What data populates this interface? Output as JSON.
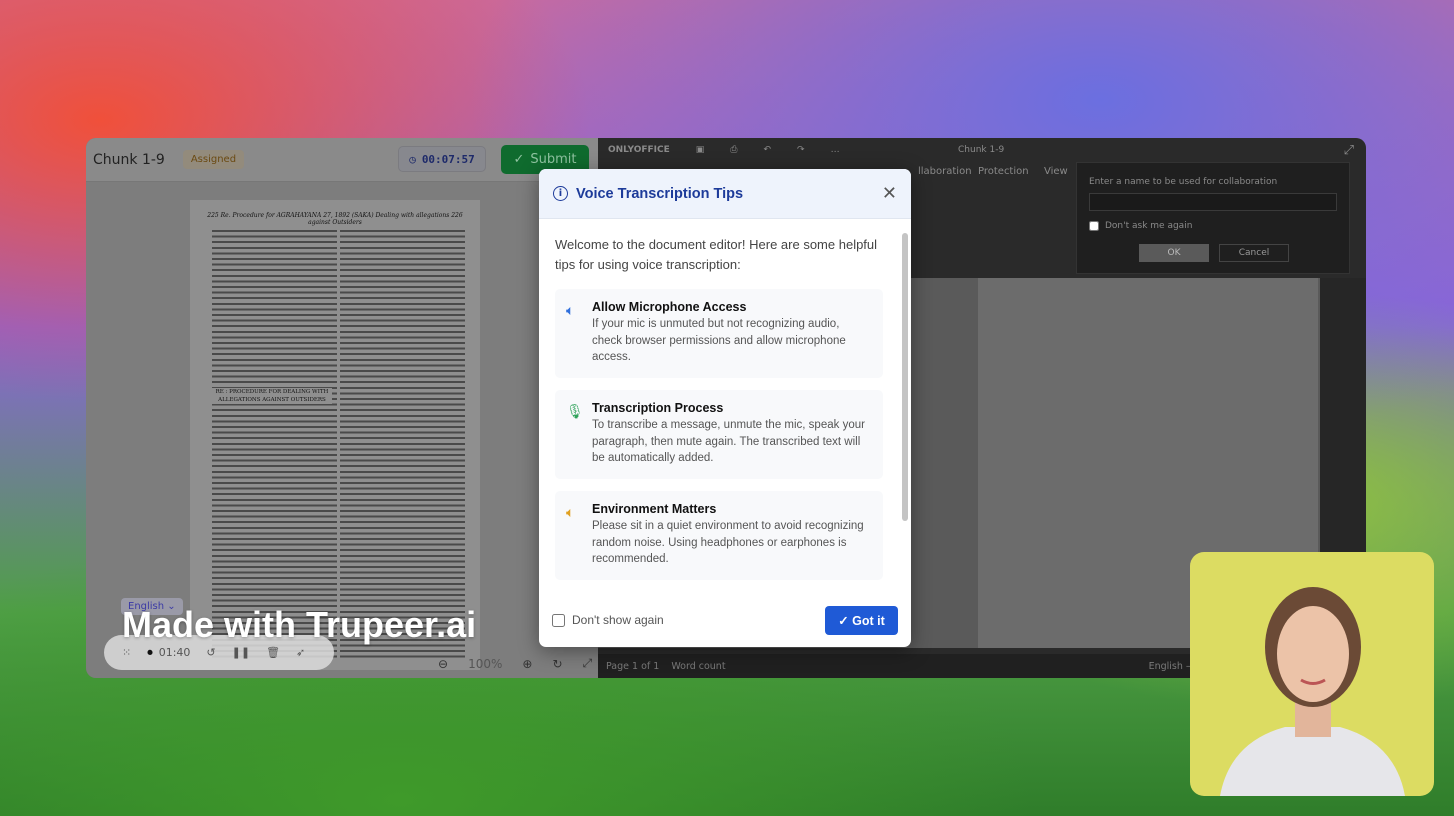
{
  "left_panel": {
    "title": "Chunk 1-9",
    "status_badge": "Assigned",
    "timer": "00:07:57",
    "submit_label": "Submit",
    "document": {
      "header": "225 Re. Procedure for AGRAHAYANA 27, 1892 (SAKA) Dealing with allegations 226 against Outsiders",
      "section_heading": "RE : PROCEDURE FOR DEALING WITH ALLEGATIONS AGAINST OUTSIDERS"
    },
    "language": "English",
    "zoom_level": "100%"
  },
  "recorder": {
    "elapsed": "01:40"
  },
  "watermark": "Made with Trupeer.ai",
  "editor": {
    "brand": "ONLYOFFICE",
    "doc_title": "Chunk 1-9",
    "tabs": [
      "llaboration",
      "Protection",
      "View"
    ],
    "collab_dialog": {
      "label": "Enter a name to be used for collaboration",
      "checkbox": "Don't ask me again",
      "ok": "OK",
      "cancel": "Cancel"
    },
    "status": {
      "page": "Page 1 of 1",
      "word_count": "Word count",
      "language": "English – United States"
    }
  },
  "modal": {
    "title": "Voice Transcription Tips",
    "intro": "Welcome to the document editor! Here are some helpful tips for using voice transcription:",
    "tips": [
      {
        "icon": "speaker-icon",
        "color": "#2f6fdc",
        "title": "Allow Microphone Access",
        "text": "If your mic is unmuted but not recognizing audio, check browser permissions and allow microphone access."
      },
      {
        "icon": "microphone-icon",
        "color": "#2fa35a",
        "title": "Transcription Process",
        "text": "To transcribe a message, unmute the mic, speak your paragraph, then mute again. The transcribed text will be automatically added."
      },
      {
        "icon": "speaker-icon",
        "color": "#e0a020",
        "title": "Environment Matters",
        "text": "Please sit in a quiet environment to avoid recognizing random noise. Using headphones or earphones is recommended."
      }
    ],
    "dont_show": "Don't show again",
    "got_it": "Got it"
  }
}
